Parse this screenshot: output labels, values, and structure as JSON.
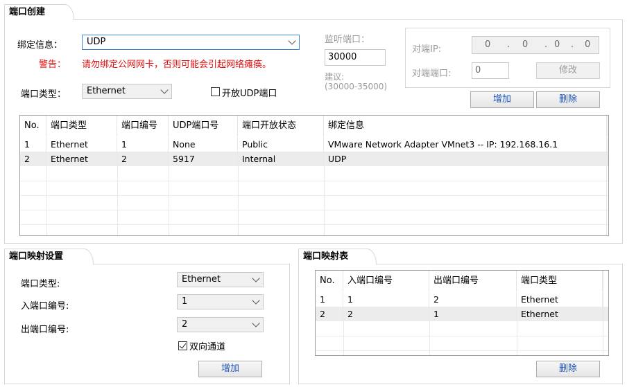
{
  "port_create": {
    "title": "端口创建",
    "bind_label": "绑定信息：",
    "bind_value": "UDP",
    "warning_label": "警告：",
    "warning_text": "请勿绑定公网网卡，否则可能会引起网络瘫痪。",
    "port_type_label": "端口类型：",
    "port_type_value": "Ethernet",
    "open_udp_label": "开放UDP端口",
    "listen_label": "监听端口：",
    "listen_value": "30000",
    "suggest_label": "建议:",
    "suggest_range": "(30000-35000)",
    "peer_ip_label": "对端IP:",
    "peer_ip": [
      "0",
      "0",
      "0",
      "0"
    ],
    "peer_port_label": "对端端口:",
    "peer_port_value": "0",
    "modify_button": "修改",
    "add_button": "增加",
    "delete_button": "删除",
    "table": {
      "headers": [
        "No.",
        "端口类型",
        "端口编号",
        "UDP端口号",
        "端口开放状态",
        "绑定信息"
      ],
      "rows": [
        [
          "1",
          "Ethernet",
          "1",
          "None",
          "Public",
          "VMware Network Adapter VMnet3 -- IP: 192.168.16.1"
        ],
        [
          "2",
          "Ethernet",
          "2",
          "5917",
          "Internal",
          "UDP"
        ]
      ]
    }
  },
  "port_map_settings": {
    "title": "端口映射设置",
    "type_label": "端口类型:",
    "type_value": "Ethernet",
    "in_label": "入端口编号:",
    "in_value": "1",
    "out_label": "出端口编号:",
    "out_value": "2",
    "bidirectional_label": "双向通道",
    "add_button": "增加"
  },
  "port_map_table": {
    "title": "端口映射表",
    "headers": [
      "No.",
      "入端口编号",
      "出端口编号",
      "端口类型"
    ],
    "rows": [
      [
        "1",
        "1",
        "2",
        "Ethernet"
      ],
      [
        "2",
        "2",
        "1",
        "Ethernet"
      ]
    ],
    "delete_button": "删除"
  }
}
